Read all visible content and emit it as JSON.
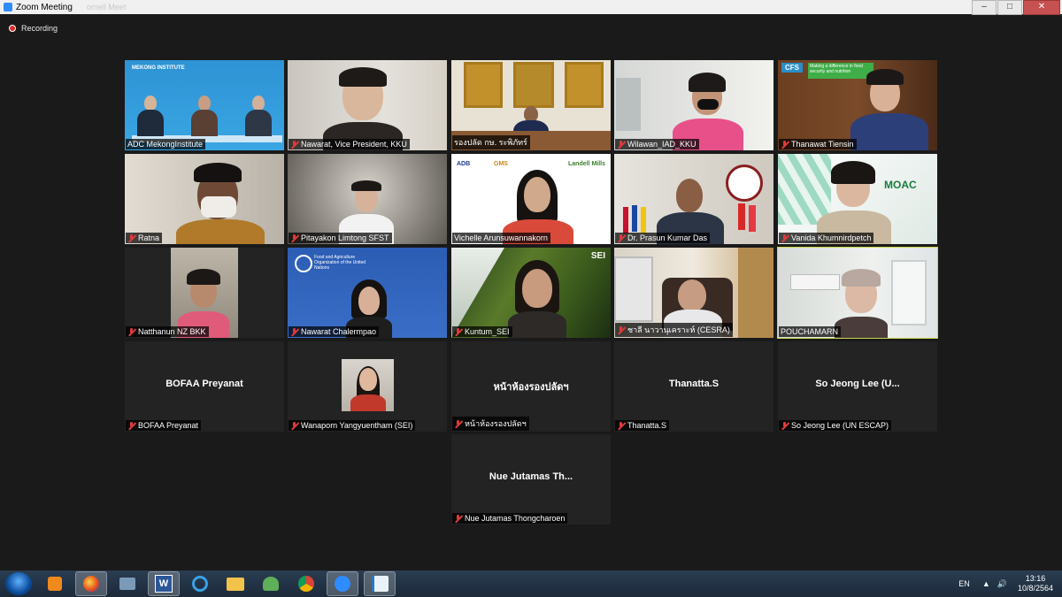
{
  "window": {
    "title": "Zoom Meeting",
    "ghost_title": "ornell Meet",
    "minimize": "–",
    "maximize": "□",
    "close": "✕"
  },
  "recording": {
    "label": "Recording"
  },
  "participants": [
    {
      "name": "ADC MekongInstitute",
      "muted": false,
      "video": true
    },
    {
      "name": "Nawarat, Vice President, KKU",
      "muted": true,
      "video": true
    },
    {
      "name": "รองปลัด กษ. ระพิภัทร์",
      "muted": false,
      "video": true
    },
    {
      "name": "Wilawan_IAD_KKU",
      "muted": true,
      "video": true
    },
    {
      "name": "Thanawat Tiensin",
      "muted": true,
      "video": true
    },
    {
      "name": "Ratna",
      "muted": true,
      "video": true
    },
    {
      "name": "Pitayakon Limtong SFST",
      "muted": true,
      "video": true
    },
    {
      "name": "Vichelle Arunsuwannakorn",
      "muted": false,
      "video": true
    },
    {
      "name": "Dr. Prasun Kumar Das",
      "muted": true,
      "video": true
    },
    {
      "name": "Vanida Khumnirdpetch",
      "muted": true,
      "video": true
    },
    {
      "name": "Natthanun NZ BKK",
      "muted": true,
      "video": true
    },
    {
      "name": "Nawarat Chalermpao",
      "muted": true,
      "video": true
    },
    {
      "name": "Kuntum_SEI",
      "muted": true,
      "video": true
    },
    {
      "name": "ชาลี นาวานุเคราะห์ (CESRA)",
      "muted": true,
      "video": true
    },
    {
      "name": "POUCHAMARN",
      "muted": false,
      "video": true,
      "active_speaker": true
    },
    {
      "name": "BOFAA Preyanat",
      "display": "BOFAA Preyanat",
      "muted": true,
      "video": false
    },
    {
      "name": "Wanaporn Yangyuentham (SEI)",
      "muted": true,
      "video": false,
      "has_photo": true
    },
    {
      "name": "หน้าห้องรองปลัดฯ",
      "display": "หน้าห้องรองปลัดฯ",
      "muted": true,
      "video": false
    },
    {
      "name": "Thanatta.S",
      "display": "Thanatta.S",
      "muted": true,
      "video": false
    },
    {
      "name": "So Jeong Lee (UN ESCAP)",
      "display": "So Jeong Lee (U...",
      "muted": true,
      "video": false
    },
    {
      "name": "Nue Jutamas Thongcharoen",
      "display": "Nue Jutamas Th...",
      "muted": true,
      "video": false
    }
  ],
  "backgrounds": {
    "mekong_brand": "MEKONG INSTITUTE",
    "cfs_badge": "CFS",
    "cfs_tagline": "Making a difference in food security and nutrition",
    "adb": "ADB",
    "gms": "GMS",
    "landell": "Landell Mills",
    "fao": "Food and Agriculture Organization of the United Nations",
    "sei": "SEI",
    "moac": "MOAC"
  },
  "taskbar": {
    "icons": [
      "start-orb",
      "media-player",
      "firefox",
      "network-app",
      "word",
      "internet-explorer",
      "file-explorer",
      "people-app",
      "chrome",
      "zoom",
      "quill-app"
    ],
    "language": "EN",
    "time": "13:16",
    "date": "10/8/2564"
  },
  "colors": {
    "meeting_bg": "#1a1a1a",
    "tile_bg": "#232323",
    "active_speaker": "#c8d74a",
    "mute_red": "#e03a3a",
    "taskbar": "#1c2a3a"
  }
}
